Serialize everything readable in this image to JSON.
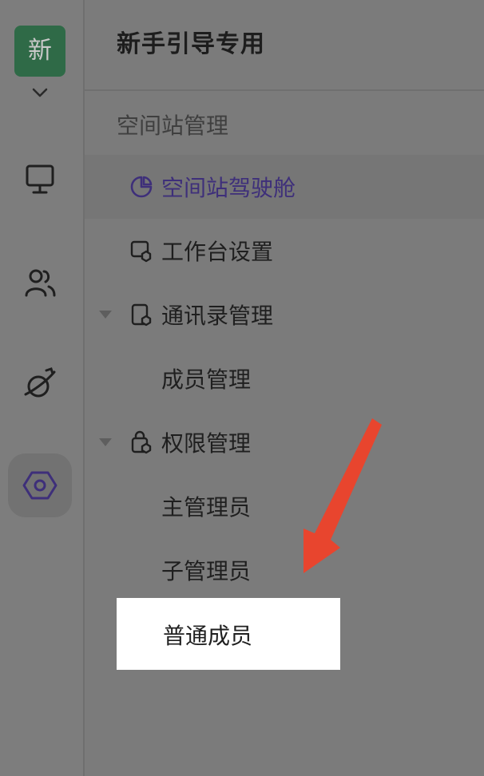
{
  "workspace": {
    "logo_text": "新",
    "title": "新手引导专用"
  },
  "section": {
    "label": "空间站管理"
  },
  "menu": {
    "cockpit": "空间站驾驶舱",
    "workbench": "工作台设置",
    "contacts": "通讯录管理",
    "members": "成员管理",
    "permissions": "权限管理",
    "main_admin": "主管理员",
    "sub_admin": "子管理员",
    "regular_member": "普通成员"
  },
  "icons": {
    "rail": [
      "chevron-down-icon",
      "monitor-icon",
      "users-icon",
      "planet-icon",
      "hexagon-settings-icon"
    ],
    "menu": [
      "pie-chart-icon",
      "workbench-settings-icon",
      "contacts-book-icon",
      "lock-settings-icon"
    ]
  },
  "colors": {
    "accent": "#3e2f7a",
    "logo_bg": "#2f6a47",
    "arrow": "#e8452e",
    "overlay": "#7b7b7b"
  }
}
